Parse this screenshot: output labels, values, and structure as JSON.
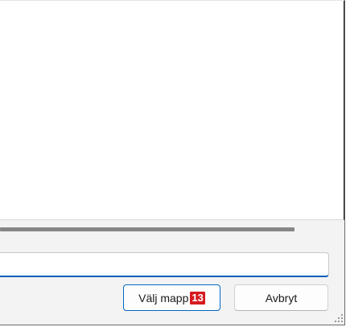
{
  "dialog": {
    "folder_input": {
      "value": "",
      "placeholder": ""
    },
    "buttons": {
      "select_folder_label": "Välj mapp",
      "select_folder_badge": "13",
      "cancel_label": "Avbryt"
    }
  },
  "icons": {
    "resize_grip": "resize-grip-icon"
  },
  "colors": {
    "accent": "#005fb8",
    "badge": "#d7191f"
  }
}
